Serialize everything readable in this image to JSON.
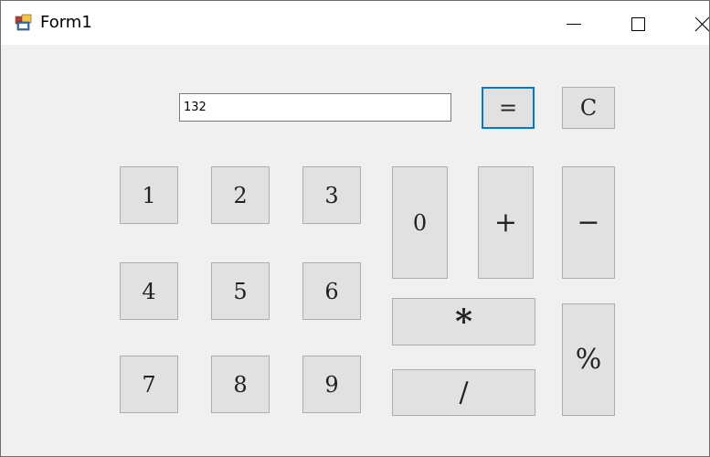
{
  "window": {
    "title": "Form1",
    "controls": {
      "minimize_icon": "minimize-icon",
      "maximize_icon": "maximize-icon",
      "close_icon": "close-icon"
    }
  },
  "display": {
    "value": "132"
  },
  "buttons": {
    "equals": "=",
    "clear": "C",
    "one": "1",
    "two": "2",
    "three": "3",
    "four": "4",
    "five": "5",
    "six": "6",
    "seven": "7",
    "eight": "8",
    "nine": "9",
    "zero": "0",
    "plus": "+",
    "minus": "−",
    "multiply": "*",
    "divide": "/",
    "percent": "%"
  },
  "colors": {
    "focus_border": "#0078d7",
    "button_face": "#e1e1e1",
    "form_background": "#f0f0f0"
  }
}
